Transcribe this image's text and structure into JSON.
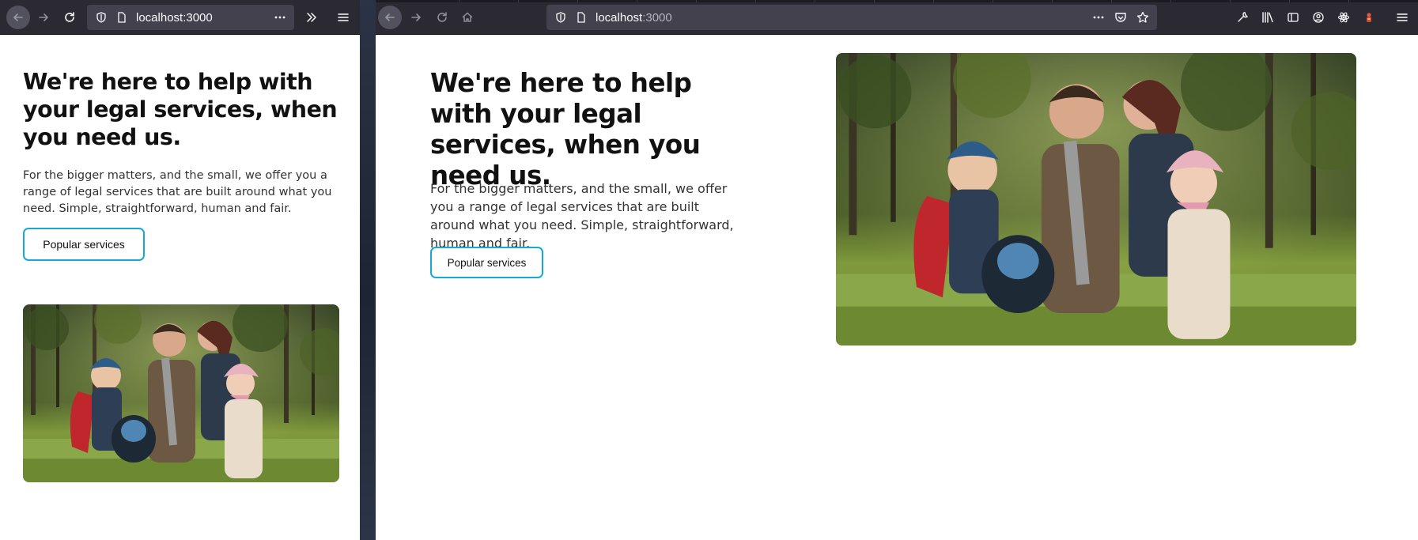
{
  "browser": {
    "url_host": "localhost",
    "url_port": ":3000",
    "url_full": "localhost:3000"
  },
  "icons": {
    "back": "back-arrow-icon",
    "forward": "forward-arrow-icon",
    "reload": "reload-icon",
    "home": "home-icon",
    "tracking_protection": "shield-icon",
    "page_info": "page-icon",
    "page_actions": "more-icon",
    "pocket": "pocket-icon",
    "bookmark": "star-icon",
    "overflow": "chevrons-right-icon",
    "menu": "hamburger-menu-icon",
    "devtools": "wrench-icon",
    "library": "library-icon",
    "sidebar": "sidebar-icon",
    "account": "account-icon",
    "react_devtools": "react-icon",
    "extension": "extension-icon"
  },
  "hero": {
    "title": "We're here to help with your legal services, when you need us.",
    "text": "For the bigger matters, and the small, we offer you a range of legal services that are built around what you need. Simple, straightforward, human and fair.",
    "cta_label": "Popular services",
    "image_subject": "family-hiking-photo"
  },
  "colors": {
    "accent": "#17a9d6",
    "toolbar": "#2b2a33",
    "urlbar": "#42414d"
  }
}
